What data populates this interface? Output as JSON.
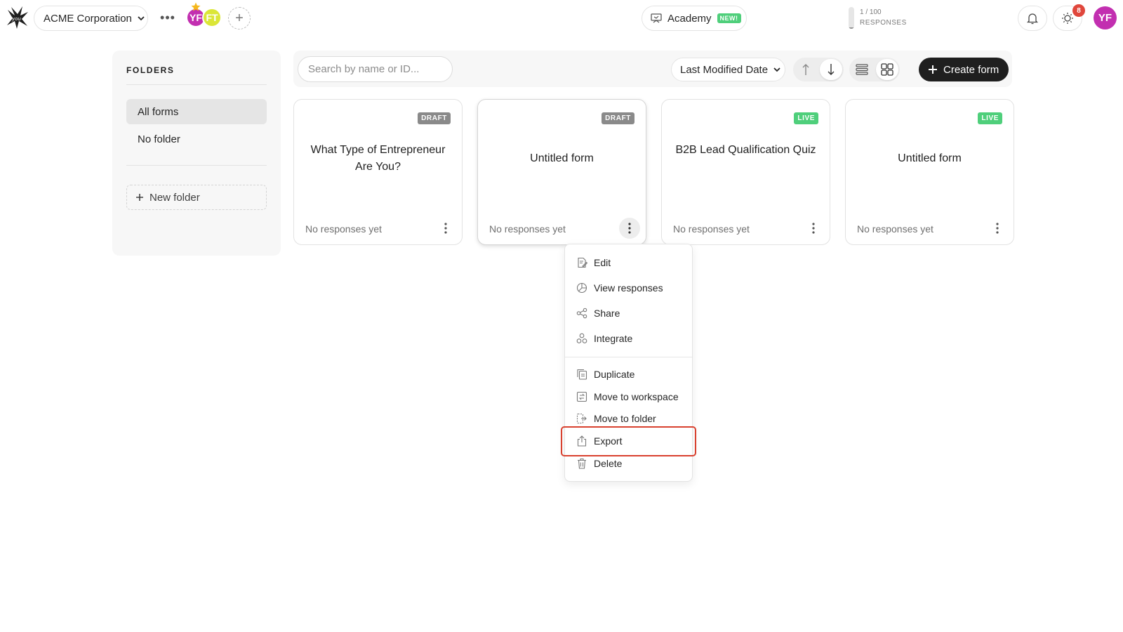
{
  "topbar": {
    "workspace_name": "ACME Corporation",
    "more_label": "•••",
    "members": [
      {
        "initials": "YF",
        "color": "#c22fb0"
      },
      {
        "initials": "FT",
        "color": "#dbe637"
      }
    ],
    "add_member_label": "+",
    "academy": {
      "label": "Academy",
      "badge": "NEW!"
    },
    "responses": {
      "count": "1 / 100",
      "label": "RESPONSES",
      "used_fraction": 0.01
    },
    "notification_count": "8",
    "user_initials": "YF"
  },
  "sidebar": {
    "heading": "FOLDERS",
    "items": [
      {
        "label": "All forms",
        "active": true
      },
      {
        "label": "No folder",
        "active": false
      }
    ],
    "new_folder_label": "New folder"
  },
  "toolbar": {
    "search_placeholder": "Search by name or ID...",
    "sort_label": "Last Modified Date",
    "create_label": "Create form"
  },
  "cards": [
    {
      "title": "What Type of Entrepreneur Are You?",
      "status": "DRAFT",
      "footer": "No responses yet"
    },
    {
      "title": "Untitled form",
      "status": "DRAFT",
      "footer": "No responses yet"
    },
    {
      "title": "B2B Lead Qualification Quiz",
      "status": "LIVE",
      "footer": "No responses yet"
    },
    {
      "title": "Untitled form",
      "status": "LIVE",
      "footer": "No responses yet"
    }
  ],
  "menu": {
    "items": [
      {
        "label": "Edit",
        "icon": "edit-icon"
      },
      {
        "label": "View responses",
        "icon": "chart-icon"
      },
      {
        "label": "Share",
        "icon": "share-icon"
      },
      {
        "label": "Integrate",
        "icon": "integrate-icon"
      },
      {
        "label": "Duplicate",
        "icon": "duplicate-icon"
      },
      {
        "label": "Move to workspace",
        "icon": "move-workspace-icon"
      },
      {
        "label": "Move to folder",
        "icon": "move-folder-icon"
      },
      {
        "label": "Export",
        "icon": "export-icon"
      },
      {
        "label": "Delete",
        "icon": "trash-icon"
      }
    ]
  },
  "colors": {
    "draft_badge": "#8a8a8a",
    "live_badge": "#4fcf7b",
    "primary_button": "#1f1f1f",
    "highlight": "#d9412f",
    "notification_badge": "#e0473c"
  }
}
